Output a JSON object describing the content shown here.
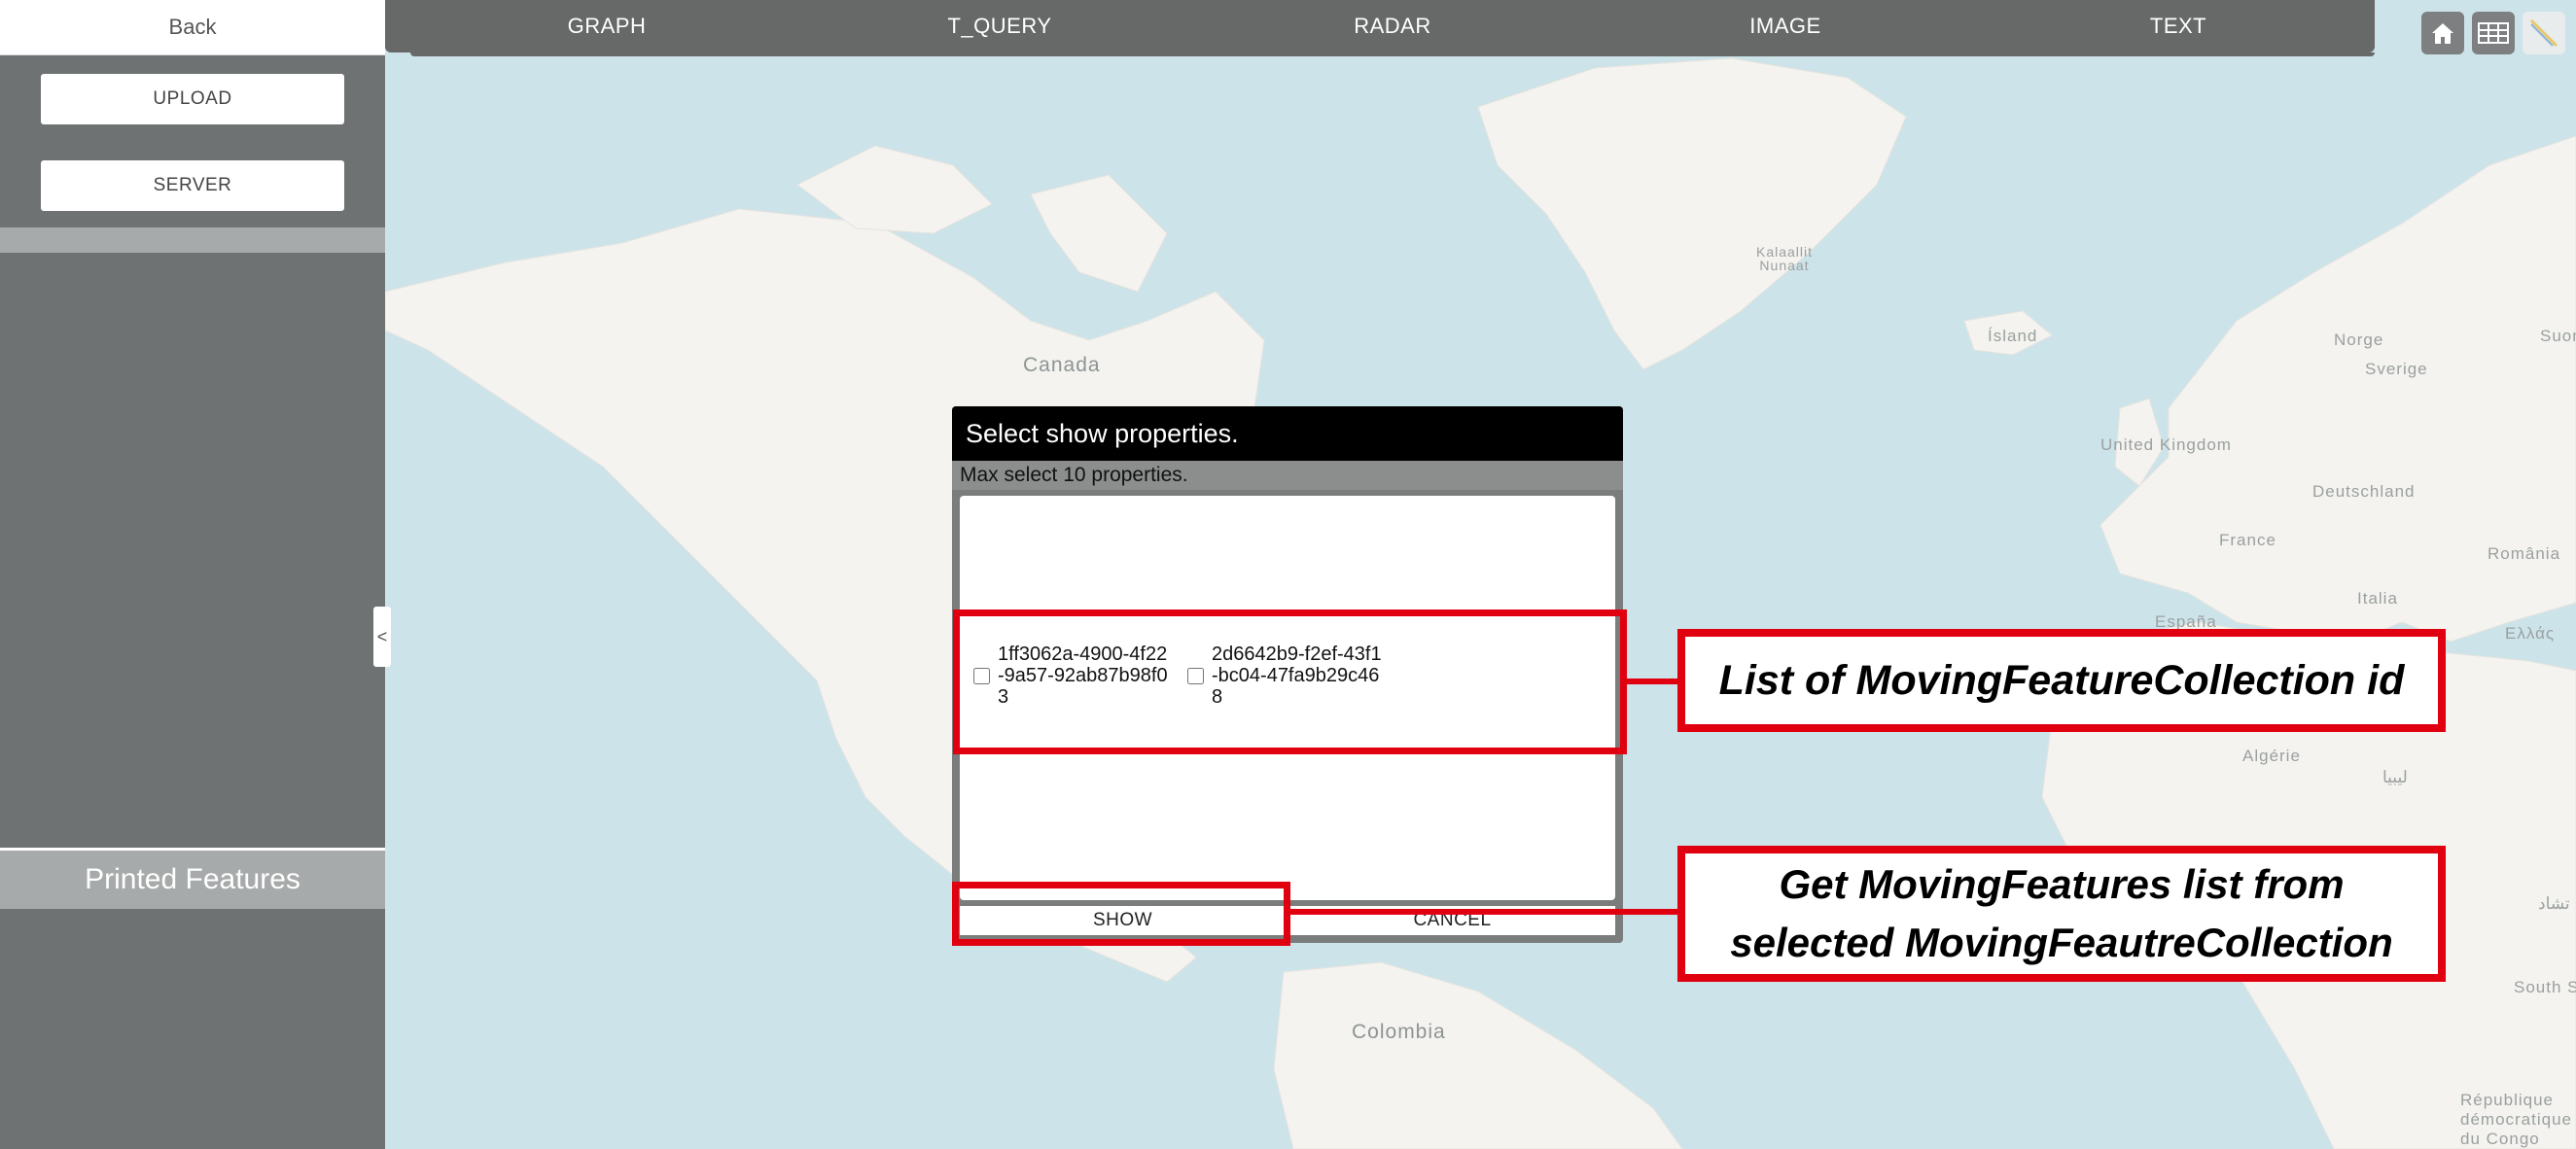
{
  "sidebar": {
    "back_label": "Back",
    "upload_label": "UPLOAD",
    "server_label": "SERVER",
    "printed_features_label": "Printed Features",
    "collapse_glyph": "<"
  },
  "nav": {
    "tabs": [
      "GRAPH",
      "T_QUERY",
      "RADAR",
      "IMAGE",
      "TEXT"
    ],
    "tools": [
      "home-icon",
      "grid-icon",
      "ruler-icon"
    ]
  },
  "map": {
    "labels": [
      "Canada",
      "Kalaallit Nunaat",
      "Ísland",
      "Norge",
      "Sverige",
      "Suomi",
      "United Kingdom",
      "Deutschland",
      "France",
      "România",
      "Italia",
      "España",
      "Ελλάς",
      "Algérie",
      "ليبيا",
      "تشاد",
      "South S",
      "Colombia",
      "République démocratique du Congo"
    ]
  },
  "dialog": {
    "title": "Select show properties.",
    "subtitle": "Max select 10 properties.",
    "items": [
      {
        "id": "1ff3062a-4900-4f22-9a57-92ab87b98f03",
        "checked": false
      },
      {
        "id": "2d6642b9-f2ef-43f1-bc04-47fa9b29c468",
        "checked": false
      }
    ],
    "show_label": "SHOW",
    "cancel_label": "CANCEL"
  },
  "annotations": {
    "list_callout": "List of MovingFeatureCollection id",
    "show_callout": "Get MovingFeatures list from selected MovingFeautreCollection"
  },
  "colors": {
    "sidebar": "#6f7272",
    "nav": "#676868",
    "ocean": "#cde3ea",
    "land": "#f4f3ef",
    "annotation": "#e0000f"
  }
}
